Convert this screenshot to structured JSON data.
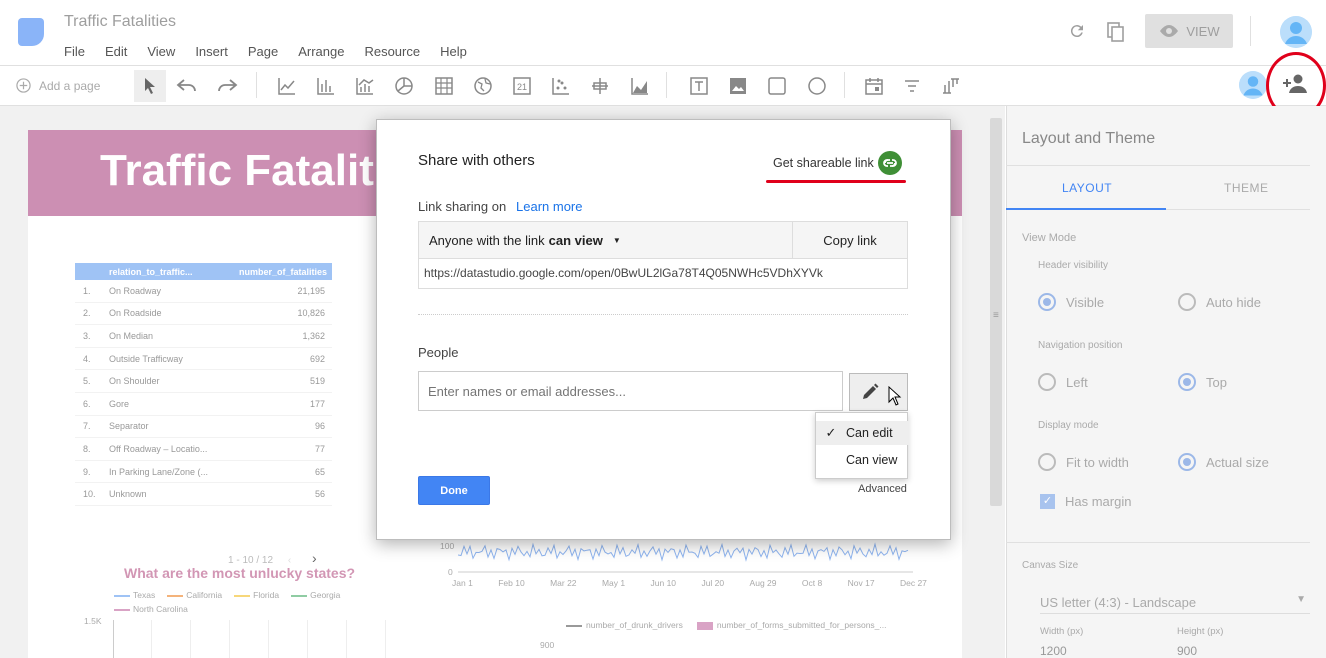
{
  "app": {
    "title": "Traffic Fatalities",
    "menu": [
      "File",
      "Edit",
      "View",
      "Insert",
      "Page",
      "Arrange",
      "Resource",
      "Help"
    ],
    "view_label": "VIEW"
  },
  "toolbar": {
    "add_page": "Add a page"
  },
  "report": {
    "banner_title": "Traffic Fatalities",
    "table": {
      "headers": [
        "relation_to_traffic...",
        "number_of_fatalities"
      ],
      "rows": [
        [
          "1.",
          "On Roadway",
          "21,195"
        ],
        [
          "2.",
          "On Roadside",
          "10,826"
        ],
        [
          "3.",
          "On Median",
          "1,362"
        ],
        [
          "4.",
          "Outside Trafficway",
          "692"
        ],
        [
          "5.",
          "On Shoulder",
          "519"
        ],
        [
          "6.",
          "Gore",
          "177"
        ],
        [
          "7.",
          "Separator",
          "96"
        ],
        [
          "8.",
          "Off Roadway – Locatio...",
          "77"
        ],
        [
          "9.",
          "In Parking Lane/Zone (...",
          "65"
        ],
        [
          "10.",
          "Unknown",
          "56"
        ]
      ]
    },
    "states_chart": {
      "title": "What are the most unlucky states?",
      "pager": "1 - 10 / 12",
      "legend": [
        "Texas",
        "California",
        "Florida",
        "Georgia",
        "North Carolina"
      ],
      "y_tick": "1.5K"
    },
    "timeline": {
      "x_ticks": [
        "Jan 1",
        "Feb 10",
        "Mar 22",
        "May 1",
        "Jun 10",
        "Jul 20",
        "Aug 29",
        "Oct 8",
        "Nov 17",
        "Dec 27"
      ],
      "y_ticks": [
        "100",
        "0"
      ],
      "legend": [
        "number_of_drunk_drivers",
        "number_of_forms_submitted_for_persons_..."
      ],
      "y2_tick": "900"
    }
  },
  "right_panel": {
    "title": "Layout and Theme",
    "tabs": [
      "LAYOUT",
      "THEME"
    ],
    "view_mode": "View Mode",
    "header_visibility": "Header visibility",
    "hv_options": [
      "Visible",
      "Auto hide"
    ],
    "nav_position": "Navigation position",
    "nav_options": [
      "Left",
      "Top"
    ],
    "display_mode": "Display mode",
    "dm_options": [
      "Fit to width",
      "Actual size"
    ],
    "has_margin": "Has margin",
    "canvas_size": "Canvas Size",
    "canvas_value": "US letter (4:3) - Landscape",
    "width_label": "Width (px)",
    "height_label": "Height (px)",
    "width_value": "1200",
    "height_value": "900"
  },
  "share_dialog": {
    "title": "Share with others",
    "get_link": "Get shareable link",
    "link_sharing": "Link sharing on",
    "learn_more": "Learn more",
    "access_prefix": "Anyone with the link",
    "access_level": "can view",
    "copy_link": "Copy link",
    "url": "https://datastudio.google.com/open/0BwUL2lGa78T4Q05NWHc5VDhXYVk",
    "people_label": "People",
    "people_placeholder": "Enter names or email addresses...",
    "perm_options": [
      "Can edit",
      "Can view"
    ],
    "done": "Done",
    "advanced": "Advanced"
  },
  "colors": {
    "accent": "#4285f4",
    "banner": "#cc8fb3",
    "annotation": "#e0001b"
  }
}
